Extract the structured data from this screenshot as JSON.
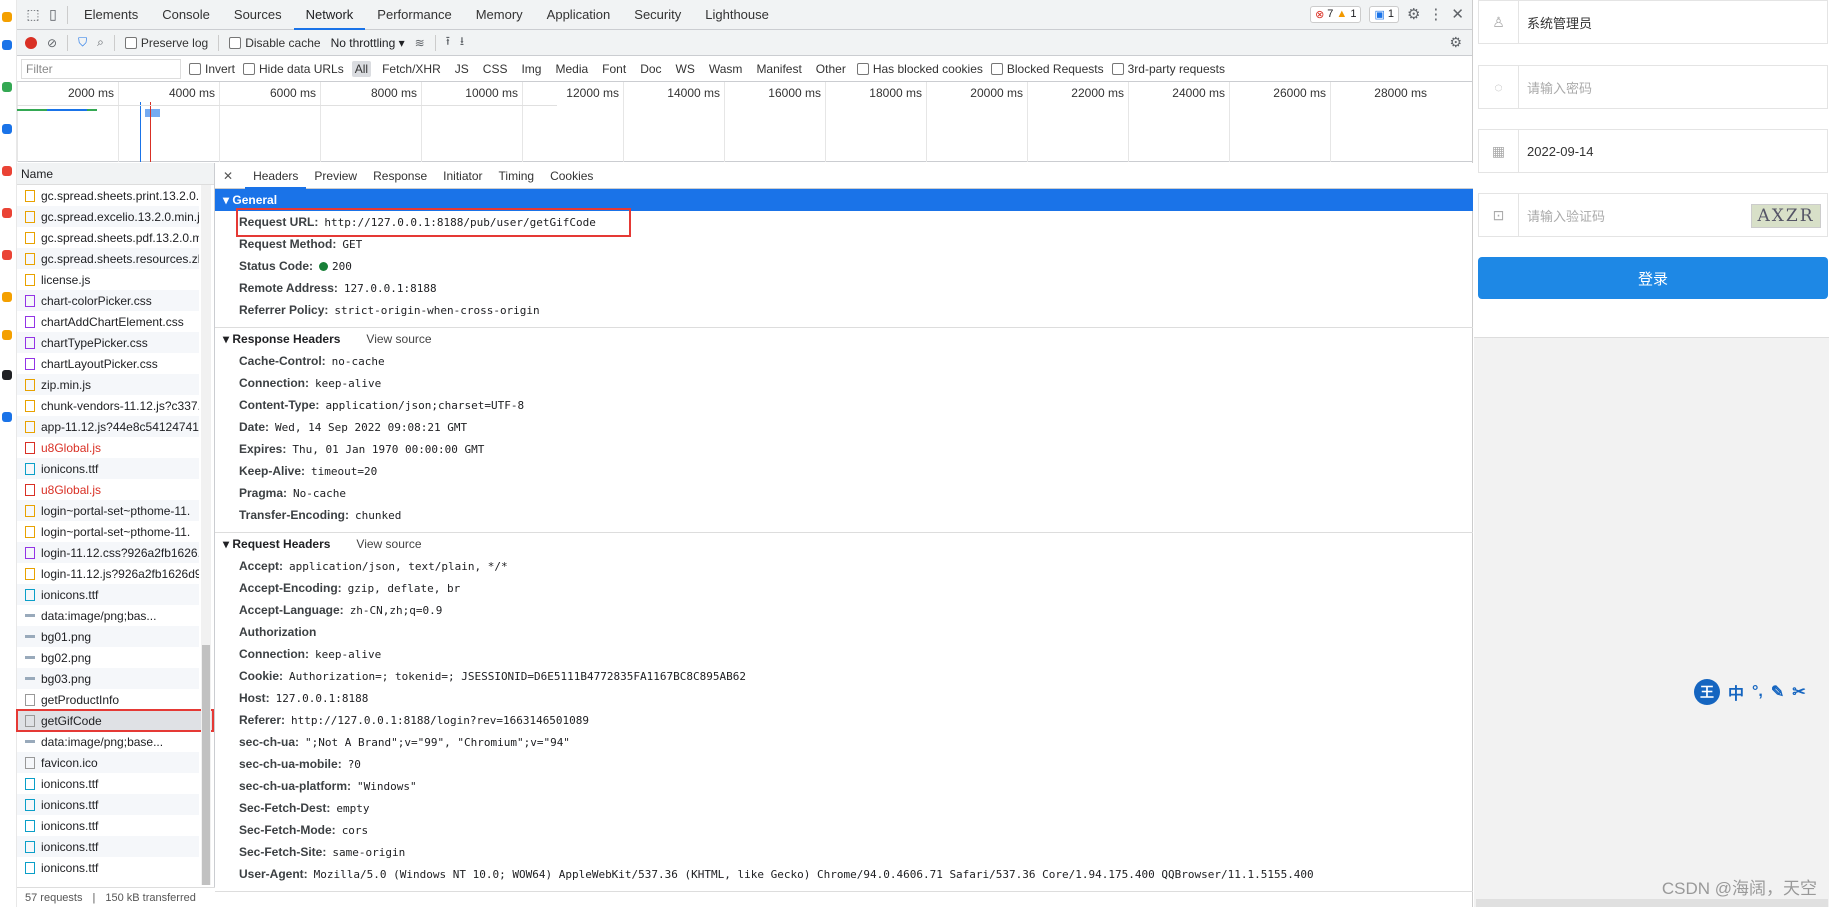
{
  "devtools": {
    "tabs": [
      "Elements",
      "Console",
      "Sources",
      "Network",
      "Performance",
      "Memory",
      "Application",
      "Security",
      "Lighthouse"
    ],
    "active_tab": "Network",
    "errors": "7",
    "warnings": "1",
    "messages": "1"
  },
  "toolbar": {
    "preserve_log": "Preserve log",
    "disable_cache": "Disable cache",
    "throttling": "No throttling"
  },
  "filter": {
    "placeholder": "Filter",
    "invert": "Invert",
    "hide_data_urls": "Hide data URLs",
    "types": [
      "All",
      "Fetch/XHR",
      "JS",
      "CSS",
      "Img",
      "Media",
      "Font",
      "Doc",
      "WS",
      "Wasm",
      "Manifest",
      "Other"
    ],
    "has_blocked_cookies": "Has blocked cookies",
    "blocked_requests": "Blocked Requests",
    "third_party": "3rd-party requests"
  },
  "timeline": {
    "ticks": [
      "2000 ms",
      "4000 ms",
      "6000 ms",
      "8000 ms",
      "10000 ms",
      "12000 ms",
      "14000 ms",
      "16000 ms",
      "18000 ms",
      "20000 ms",
      "22000 ms",
      "24000 ms",
      "26000 ms",
      "28000 ms"
    ]
  },
  "requests": {
    "header": "Name",
    "files": [
      {
        "name": "gc.spread.sheets.print.13.2.0.",
        "kind": "js"
      },
      {
        "name": "gc.spread.excelio.13.2.0.min.js",
        "kind": "js"
      },
      {
        "name": "gc.spread.sheets.pdf.13.2.0.m",
        "kind": "js"
      },
      {
        "name": "gc.spread.sheets.resources.zh",
        "kind": "js"
      },
      {
        "name": "license.js",
        "kind": "js"
      },
      {
        "name": "chart-colorPicker.css",
        "kind": "css"
      },
      {
        "name": "chartAddChartElement.css",
        "kind": "css"
      },
      {
        "name": "chartTypePicker.css",
        "kind": "css"
      },
      {
        "name": "chartLayoutPicker.css",
        "kind": "css"
      },
      {
        "name": "zip.min.js",
        "kind": "js"
      },
      {
        "name": "chunk-vendors-11.12.js?c337.",
        "kind": "js"
      },
      {
        "name": "app-11.12.js?44e8c54124741(",
        "kind": "js"
      },
      {
        "name": "u8Global.js",
        "kind": "err"
      },
      {
        "name": "ionicons.ttf",
        "kind": "font"
      },
      {
        "name": "u8Global.js",
        "kind": "err"
      },
      {
        "name": "login~portal-set~pthome-11.",
        "kind": "js"
      },
      {
        "name": "login~portal-set~pthome-11.",
        "kind": "js"
      },
      {
        "name": "login-11.12.css?926a2fb1626.",
        "kind": "css"
      },
      {
        "name": "login-11.12.js?926a2fb1626d9",
        "kind": "js"
      },
      {
        "name": "ionicons.ttf",
        "kind": "font"
      },
      {
        "name": "data:image/png;bas...",
        "kind": "img"
      },
      {
        "name": "bg01.png",
        "kind": "img"
      },
      {
        "name": "bg02.png",
        "kind": "img"
      },
      {
        "name": "bg03.png",
        "kind": "img"
      },
      {
        "name": "getProductInfo",
        "kind": "doc"
      },
      {
        "name": "getGifCode",
        "kind": "sel"
      },
      {
        "name": "data:image/png;base...",
        "kind": "img"
      },
      {
        "name": "favicon.ico",
        "kind": "doc"
      },
      {
        "name": "ionicons.ttf",
        "kind": "font"
      },
      {
        "name": "ionicons.ttf",
        "kind": "font"
      },
      {
        "name": "ionicons.ttf",
        "kind": "font"
      },
      {
        "name": "ionicons.ttf",
        "kind": "font"
      },
      {
        "name": "ionicons.ttf",
        "kind": "font"
      }
    ],
    "count": "57 requests",
    "transferred": "150 kB transferred"
  },
  "detail": {
    "tabs": [
      "Headers",
      "Preview",
      "Response",
      "Initiator",
      "Timing",
      "Cookies"
    ],
    "general": {
      "title": "General",
      "rows": [
        {
          "k": "Request URL:",
          "v": "http://127.0.0.1:8188/pub/user/getGifCode"
        },
        {
          "k": "Request Method:",
          "v": "GET"
        },
        {
          "k": "Status Code:",
          "v": "200"
        },
        {
          "k": "Remote Address:",
          "v": "127.0.0.1:8188"
        },
        {
          "k": "Referrer Policy:",
          "v": "strict-origin-when-cross-origin"
        }
      ]
    },
    "response": {
      "title": "Response Headers",
      "view_source": "View source",
      "rows": [
        {
          "k": "Cache-Control:",
          "v": "no-cache"
        },
        {
          "k": "Connection:",
          "v": "keep-alive"
        },
        {
          "k": "Content-Type:",
          "v": "application/json;charset=UTF-8"
        },
        {
          "k": "Date:",
          "v": "Wed, 14 Sep 2022 09:08:21 GMT"
        },
        {
          "k": "Expires:",
          "v": "Thu, 01 Jan 1970 00:00:00 GMT"
        },
        {
          "k": "Keep-Alive:",
          "v": "timeout=20"
        },
        {
          "k": "Pragma:",
          "v": "No-cache"
        },
        {
          "k": "Transfer-Encoding:",
          "v": "chunked"
        }
      ]
    },
    "request": {
      "title": "Request Headers",
      "view_source": "View source",
      "rows": [
        {
          "k": "Accept:",
          "v": "application/json, text/plain, */*"
        },
        {
          "k": "Accept-Encoding:",
          "v": "gzip, deflate, br"
        },
        {
          "k": "Accept-Language:",
          "v": "zh-CN,zh;q=0.9"
        },
        {
          "k": "Authorization",
          "v": ""
        },
        {
          "k": "Connection:",
          "v": "keep-alive"
        },
        {
          "k": "Cookie:",
          "v": "Authorization=; tokenid=; JSESSIONID=D6E5111B4772835FA1167BC8C895AB62"
        },
        {
          "k": "Host:",
          "v": "127.0.0.1:8188"
        },
        {
          "k": "Referer:",
          "v": "http://127.0.0.1:8188/login?rev=1663146501089"
        },
        {
          "k": "sec-ch-ua:",
          "v": "\";Not A Brand\";v=\"99\", \"Chromium\";v=\"94\""
        },
        {
          "k": "sec-ch-ua-mobile:",
          "v": "?0"
        },
        {
          "k": "sec-ch-ua-platform:",
          "v": "\"Windows\""
        },
        {
          "k": "Sec-Fetch-Dest:",
          "v": "empty"
        },
        {
          "k": "Sec-Fetch-Mode:",
          "v": "cors"
        },
        {
          "k": "Sec-Fetch-Site:",
          "v": "same-origin"
        },
        {
          "k": "User-Agent:",
          "v": "Mozilla/5.0 (Windows NT 10.0; WOW64) AppleWebKit/537.36 (KHTML, like Gecko) Chrome/94.0.4606.71 Safari/537.36 Core/1.94.175.400 QQBrowser/11.1.5155.400"
        }
      ]
    }
  },
  "login": {
    "username": "系统管理员",
    "password_placeholder": "请输入密码",
    "date": "2022-09-14",
    "captcha_placeholder": "请输入验证码",
    "captcha_text": "AXZR",
    "login_button": "登录"
  },
  "ime": {
    "label": "王",
    "items": [
      "中",
      "°,",
      "✎",
      "✂"
    ]
  },
  "watermark": "CSDN @海阔，天空",
  "colors": {
    "accent": "#1a73e8",
    "error": "#d93025",
    "login_button": "#1e88e5",
    "highlight_box": "#e53935"
  }
}
